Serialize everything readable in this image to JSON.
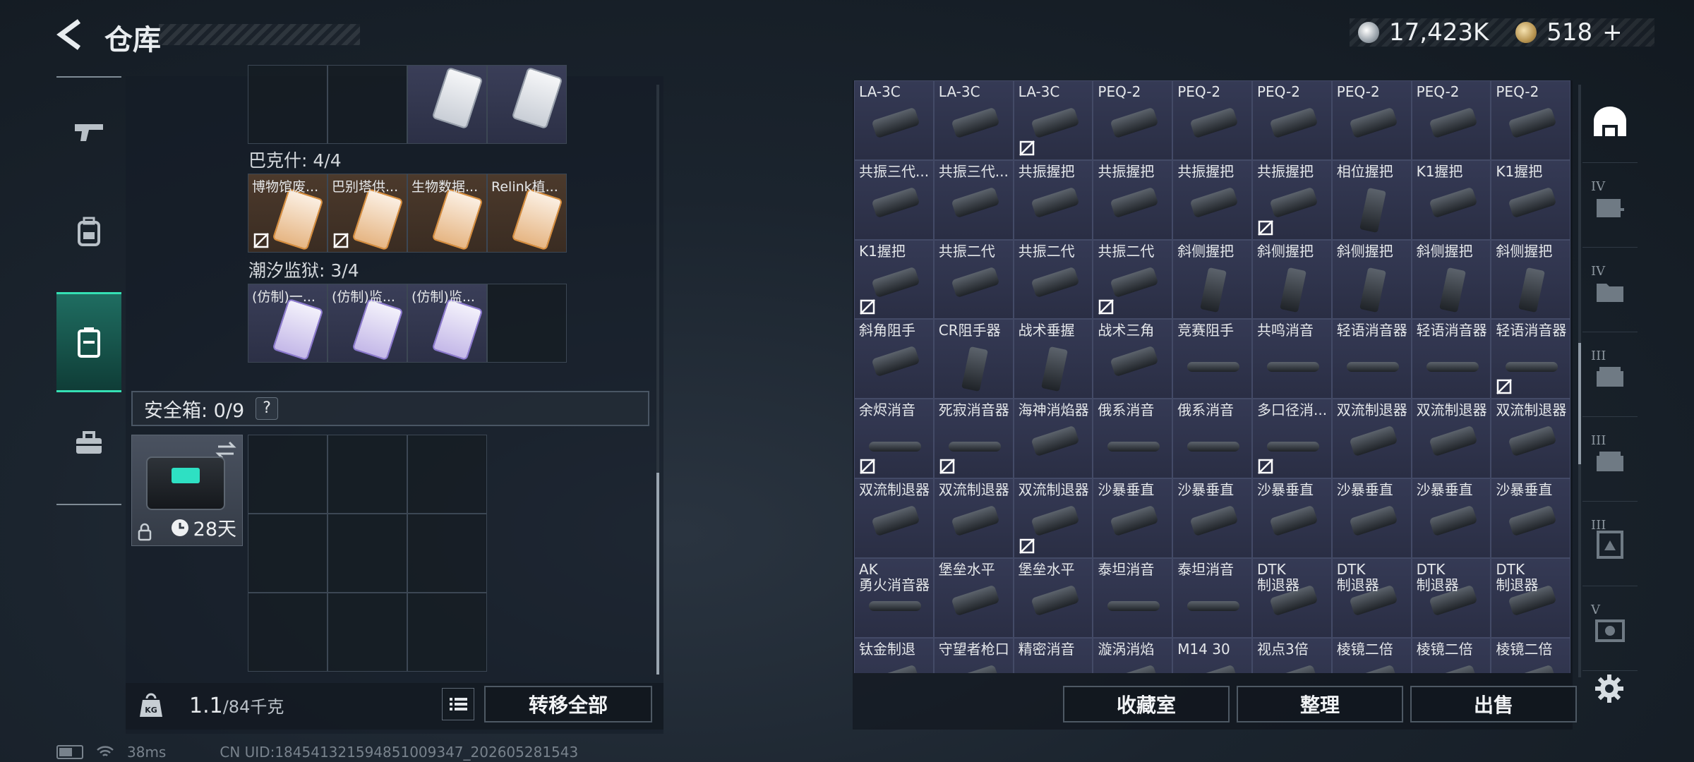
{
  "header": {
    "title": "仓库",
    "currency_silver": "17,423K",
    "currency_gold": "518",
    "add_symbol": "+"
  },
  "left_rail": {
    "tabs": [
      {
        "icon": "gun-icon",
        "active": false
      },
      {
        "icon": "backpack-icon",
        "active": false
      },
      {
        "icon": "container-icon",
        "active": true
      },
      {
        "icon": "toolbox-icon",
        "active": false
      }
    ]
  },
  "collections": [
    {
      "label": "",
      "cells": [
        {
          "text": "",
          "style": "empty"
        },
        {
          "text": "",
          "style": "empty"
        },
        {
          "text": "",
          "style": "blue",
          "card": "grey"
        },
        {
          "text": "",
          "style": "blue",
          "card": "grey"
        }
      ]
    },
    {
      "label": "巴克什: 4/4",
      "cells": [
        {
          "text": "博物馆废...",
          "style": "brown",
          "card": "orange",
          "no_deco": true
        },
        {
          "text": "巴别塔供...",
          "style": "brown",
          "card": "orange",
          "no_deco": true
        },
        {
          "text": "生物数据...",
          "style": "brown",
          "card": "orange"
        },
        {
          "text": "Relink植...",
          "style": "brown",
          "card": "orange"
        }
      ]
    },
    {
      "label": "潮汐监狱: 3/4",
      "cells": [
        {
          "text": "(仿制)一...",
          "style": "blue",
          "card": "purple"
        },
        {
          "text": "(仿制)监...",
          "style": "blue",
          "card": "purple"
        },
        {
          "text": "(仿制)监...",
          "style": "blue",
          "card": "purple"
        },
        {
          "text": "",
          "style": "empty"
        }
      ]
    }
  ],
  "safe": {
    "label": "安全箱: 0/9",
    "help": "?",
    "days": "28天"
  },
  "bottom_left": {
    "weight_value": "1.1",
    "weight_max": "/84千克",
    "transfer_all": "转移全部"
  },
  "bottom_right": {
    "collection_room": "收藏室",
    "organize": "整理",
    "sell": "出售"
  },
  "status": {
    "ping": "38ms",
    "uid": "CN UID:1845413215948510093​47_202605281543"
  },
  "items": [
    {
      "name": "LA-3C",
      "shape": "part",
      "no_deco": false
    },
    {
      "name": "LA-3C",
      "shape": "part",
      "no_deco": false
    },
    {
      "name": "LA-3C",
      "shape": "part",
      "no_deco": true
    },
    {
      "name": "PEQ-2",
      "shape": "part",
      "no_deco": false
    },
    {
      "name": "PEQ-2",
      "shape": "part",
      "no_deco": false
    },
    {
      "name": "PEQ-2",
      "shape": "part",
      "no_deco": false
    },
    {
      "name": "PEQ-2",
      "shape": "part",
      "no_deco": false
    },
    {
      "name": "PEQ-2",
      "shape": "part",
      "no_deco": false
    },
    {
      "name": "PEQ-2",
      "shape": "part",
      "no_deco": false
    },
    {
      "name": "共振三代...",
      "shape": "part",
      "no_deco": false
    },
    {
      "name": "共振三代...",
      "shape": "part",
      "no_deco": false
    },
    {
      "name": "共振握把",
      "shape": "part",
      "no_deco": false
    },
    {
      "name": "共振握把",
      "shape": "part",
      "no_deco": false
    },
    {
      "name": "共振握把",
      "shape": "part",
      "no_deco": false
    },
    {
      "name": "共振握把",
      "shape": "part",
      "no_deco": true
    },
    {
      "name": "相位握把",
      "shape": "tall",
      "no_deco": false
    },
    {
      "name": "K1握把",
      "shape": "part",
      "no_deco": false
    },
    {
      "name": "K1握把",
      "shape": "part",
      "no_deco": false
    },
    {
      "name": "K1握把",
      "shape": "part",
      "no_deco": true
    },
    {
      "name": "共振二代",
      "shape": "part",
      "no_deco": false
    },
    {
      "name": "共振二代",
      "shape": "part",
      "no_deco": false
    },
    {
      "name": "共振二代",
      "shape": "part",
      "no_deco": true
    },
    {
      "name": "斜侧握把",
      "shape": "tall",
      "no_deco": false
    },
    {
      "name": "斜侧握把",
      "shape": "tall",
      "no_deco": false
    },
    {
      "name": "斜侧握把",
      "shape": "tall",
      "no_deco": false
    },
    {
      "name": "斜侧握把",
      "shape": "tall",
      "no_deco": false
    },
    {
      "name": "斜侧握把",
      "shape": "tall",
      "no_deco": false
    },
    {
      "name": "斜角阻手",
      "shape": "part",
      "no_deco": false
    },
    {
      "name": "CR阻手器",
      "shape": "tall",
      "no_deco": false
    },
    {
      "name": "战术垂握",
      "shape": "tall",
      "no_deco": false
    },
    {
      "name": "战术三角",
      "shape": "part",
      "no_deco": false
    },
    {
      "name": "竞赛阻手",
      "shape": "long",
      "no_deco": false
    },
    {
      "name": "共鸣消音",
      "shape": "long",
      "no_deco": false
    },
    {
      "name": "轻语消音器",
      "shape": "long",
      "no_deco": false
    },
    {
      "name": "轻语消音器",
      "shape": "long",
      "no_deco": false
    },
    {
      "name": "轻语消音器",
      "shape": "long",
      "no_deco": true
    },
    {
      "name": "余烬消音",
      "shape": "long",
      "no_deco": true
    },
    {
      "name": "死寂消音器",
      "shape": "long",
      "no_deco": true
    },
    {
      "name": "海神消焰器",
      "shape": "part",
      "no_deco": false
    },
    {
      "name": "俄系消音",
      "shape": "long",
      "no_deco": false
    },
    {
      "name": "俄系消音",
      "shape": "long",
      "no_deco": false
    },
    {
      "name": "多口径消...",
      "shape": "long",
      "no_deco": true
    },
    {
      "name": "双流制退器",
      "shape": "part",
      "no_deco": false
    },
    {
      "name": "双流制退器",
      "shape": "part",
      "no_deco": false
    },
    {
      "name": "双流制退器",
      "shape": "part",
      "no_deco": false
    },
    {
      "name": "双流制退器",
      "shape": "part",
      "no_deco": false
    },
    {
      "name": "双流制退器",
      "shape": "part",
      "no_deco": false
    },
    {
      "name": "双流制退器",
      "shape": "part",
      "no_deco": true
    },
    {
      "name": "沙暴垂直",
      "shape": "part",
      "no_deco": false
    },
    {
      "name": "沙暴垂直",
      "shape": "part",
      "no_deco": false
    },
    {
      "name": "沙暴垂直",
      "shape": "part",
      "no_deco": false
    },
    {
      "name": "沙暴垂直",
      "shape": "part",
      "no_deco": false
    },
    {
      "name": "沙暴垂直",
      "shape": "part",
      "no_deco": false
    },
    {
      "name": "沙暴垂直",
      "shape": "part",
      "no_deco": false
    },
    {
      "name": "AK\n勇火消音器",
      "shape": "long",
      "no_deco": false
    },
    {
      "name": "堡垒水平",
      "shape": "part",
      "no_deco": false
    },
    {
      "name": "堡垒水平",
      "shape": "part",
      "no_deco": false
    },
    {
      "name": "泰坦消音",
      "shape": "long",
      "no_deco": false
    },
    {
      "name": "泰坦消音",
      "shape": "long",
      "no_deco": false
    },
    {
      "name": "DTK\n制退器",
      "shape": "part",
      "no_deco": false
    },
    {
      "name": "DTK\n制退器",
      "shape": "part",
      "no_deco": false
    },
    {
      "name": "DTK\n制退器",
      "shape": "part",
      "no_deco": false
    },
    {
      "name": "DTK\n制退器",
      "shape": "part",
      "no_deco": false
    },
    {
      "name": "钛金制退",
      "shape": "part",
      "no_deco": false
    },
    {
      "name": "守望者枪口",
      "shape": "part",
      "no_deco": false
    },
    {
      "name": "精密消音",
      "shape": "long",
      "no_deco": false
    },
    {
      "name": "漩涡消焰",
      "shape": "part",
      "no_deco": false
    },
    {
      "name": "M14 30",
      "shape": "part",
      "no_deco": false
    },
    {
      "name": "视点3倍",
      "shape": "part",
      "no_deco": false
    },
    {
      "name": "棱镜二倍",
      "shape": "part",
      "no_deco": false
    },
    {
      "name": "棱镜二倍",
      "shape": "part",
      "no_deco": false
    },
    {
      "name": "棱镜二倍",
      "shape": "part",
      "no_deco": false
    }
  ],
  "right_rail": {
    "tabs": [
      {
        "icon": "gate-icon",
        "tier": ""
      },
      {
        "icon": "medkit-icon",
        "tier": "IV"
      },
      {
        "icon": "folder-icon",
        "tier": "IV"
      },
      {
        "icon": "rifle-rack-icon",
        "tier": "III"
      },
      {
        "icon": "rifle-rack-icon",
        "tier": "III"
      },
      {
        "icon": "frame-icon",
        "tier": "III"
      },
      {
        "icon": "safe-icon",
        "tier": "V"
      }
    ],
    "settings_icon": "gear-icon"
  }
}
